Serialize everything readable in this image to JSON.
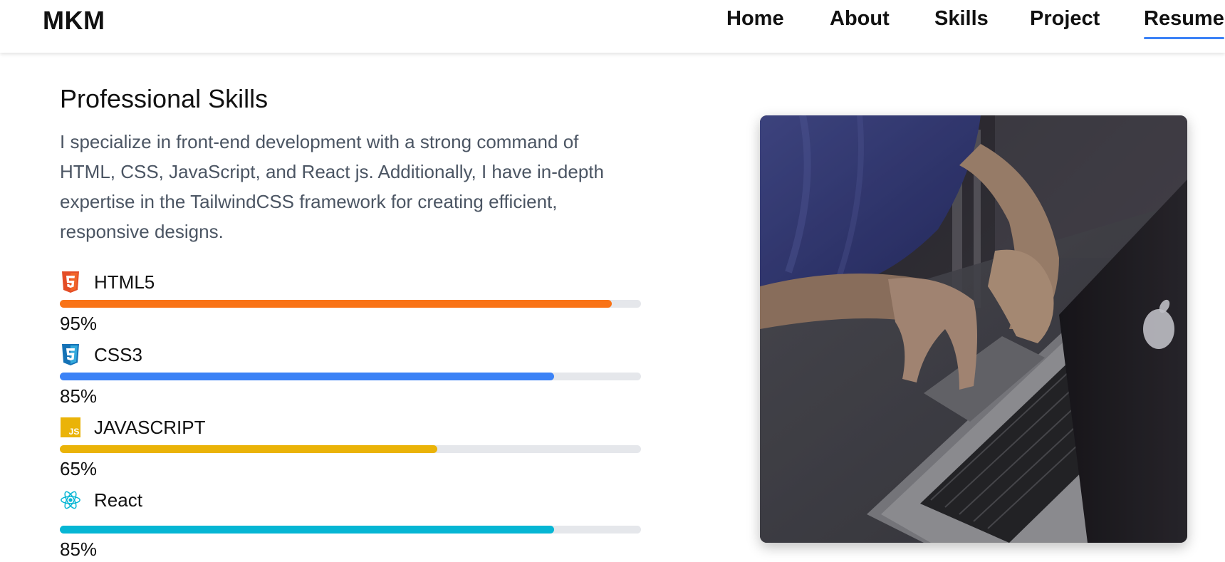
{
  "nav": {
    "logo": "MKM",
    "links": [
      {
        "label": "Home"
      },
      {
        "label": "About"
      },
      {
        "label": "Skills"
      },
      {
        "label": "Project"
      },
      {
        "label": "Resume",
        "active": true
      }
    ]
  },
  "skills_section": {
    "title": "Professional Skills",
    "description": "I specialize in front-end development with a strong command of HTML, CSS, JavaScript, and React js. Additionally, I have in-depth expertise in the TailwindCSS framework for creating efficient, responsive designs.",
    "skills": [
      {
        "name": "HTML5",
        "percent_label": "95%",
        "level": 0.95,
        "color": "#f97316",
        "icon": "html5-icon"
      },
      {
        "name": "CSS3",
        "percent_label": "85%",
        "level": 0.85,
        "color": "#3b82f6",
        "icon": "css3-icon"
      },
      {
        "name": "JAVASCRIPT",
        "percent_label": "65%",
        "level": 0.65,
        "color": "#eab308",
        "icon": "javascript-icon"
      },
      {
        "name": "React",
        "percent_label": "85%",
        "level": 0.85,
        "color": "#06b6d4",
        "icon": "react-icon"
      }
    ]
  },
  "image": {
    "subject": "person typing on laptop",
    "icon": "laptop-photo"
  }
}
